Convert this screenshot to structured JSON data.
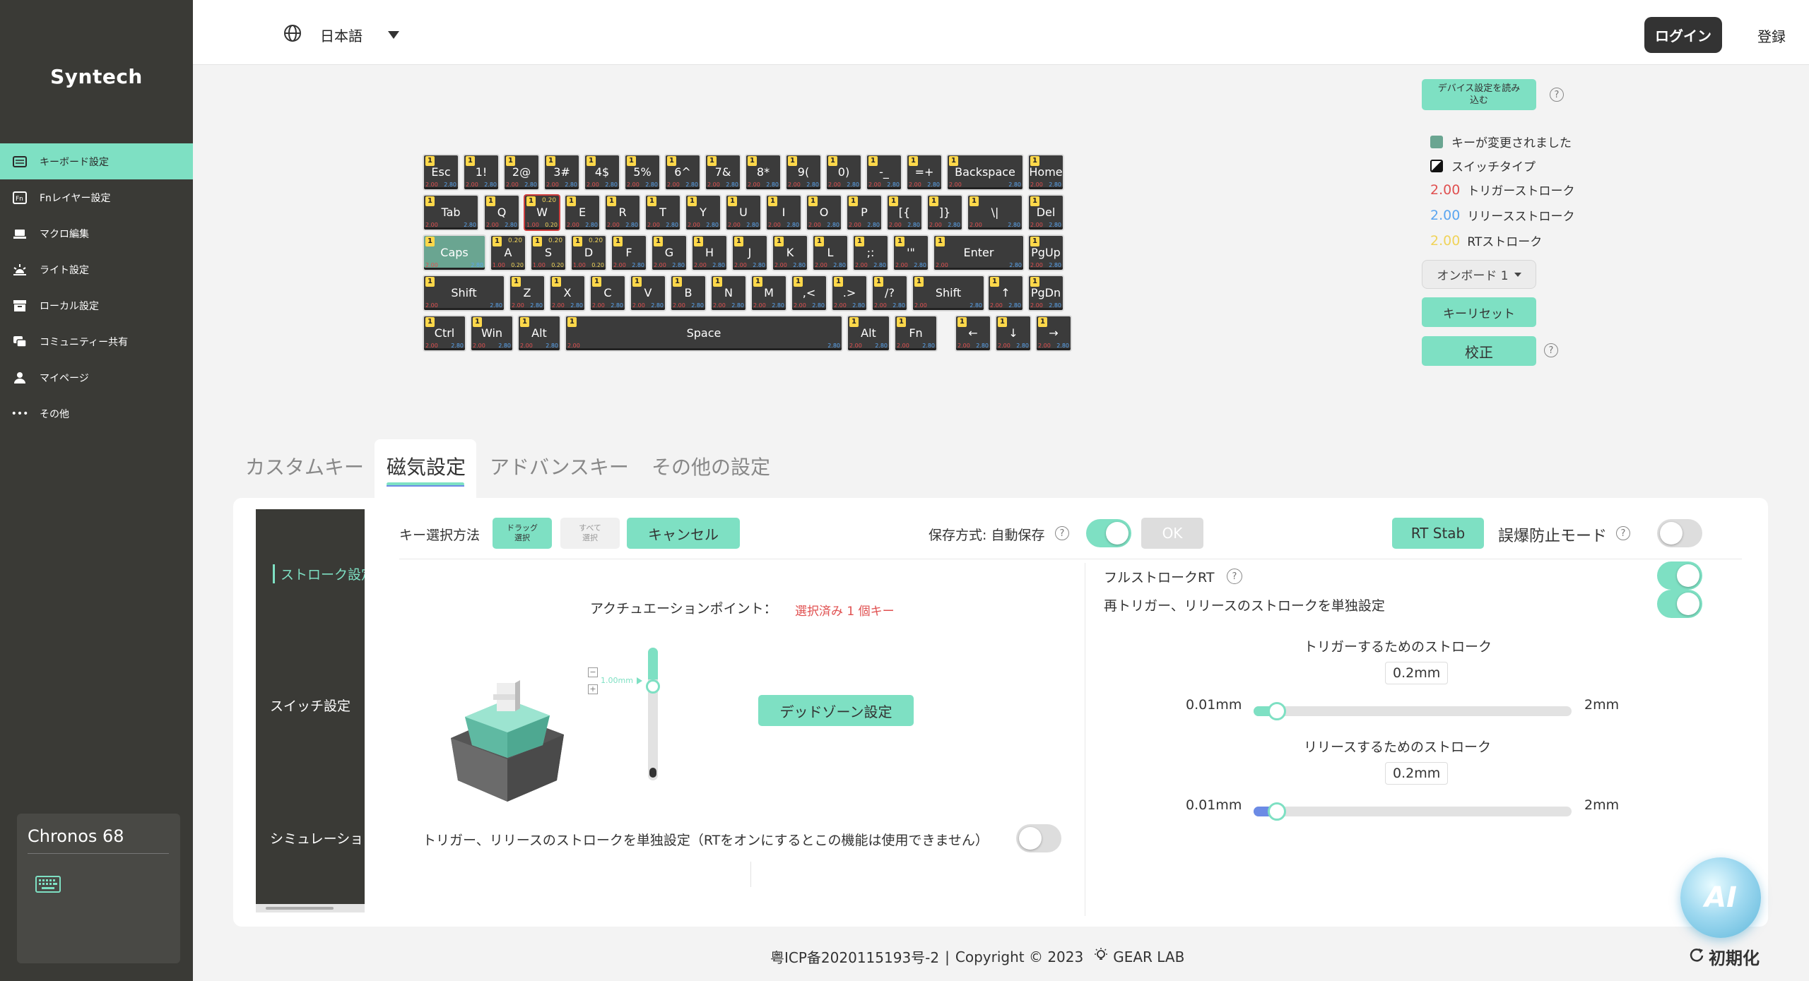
{
  "brand": "Syntech",
  "sidebar": {
    "items": [
      {
        "label": "キーボード設定",
        "icon": "keyboard-icon",
        "active": true
      },
      {
        "label": "Fnレイヤー設定",
        "icon": "fn-icon",
        "active": false
      },
      {
        "label": "マクロ編集",
        "icon": "macro-icon",
        "active": false
      },
      {
        "label": "ライト設定",
        "icon": "light-icon",
        "active": false
      },
      {
        "label": "ローカル設定",
        "icon": "archive-icon",
        "active": false
      },
      {
        "label": "コミュニティー共有",
        "icon": "community-icon",
        "active": false
      },
      {
        "label": "マイページ",
        "icon": "user-icon",
        "active": false
      },
      {
        "label": "その他",
        "icon": "more-icon",
        "active": false
      }
    ],
    "device_name": "Chronos 68"
  },
  "header": {
    "language": "日本語",
    "login": "ログイン",
    "register": "登録"
  },
  "keyboard": {
    "badge": "1",
    "trigger_default": "2.00",
    "release_default": "2.80",
    "rt_value": "0.20",
    "rt_trigger": "1.00",
    "rows": [
      [
        "Esc",
        "1!",
        "2@",
        "3#",
        "4$",
        "5%",
        "6^",
        "7&",
        "8*",
        "9(",
        "0)",
        "-_",
        "=+",
        "Backspace",
        "Home"
      ],
      [
        "Tab",
        "Q",
        "W",
        "E",
        "R",
        "T",
        "Y",
        "U",
        "I",
        "O",
        "P",
        "[{",
        "]}",
        "\\|",
        "Del"
      ],
      [
        "Caps",
        "A",
        "S",
        "D",
        "F",
        "G",
        "H",
        "J",
        "K",
        "L",
        ";:",
        "'\"",
        "Enter",
        "PgUp"
      ],
      [
        "Shift",
        "Z",
        "X",
        "C",
        "V",
        "B",
        "N",
        "M",
        ",<",
        ".>",
        "/?",
        "Shift",
        "↑",
        "PgDn"
      ],
      [
        "Ctrl",
        "Win",
        "Alt",
        "Space",
        "Alt",
        "Fn",
        "←",
        "↓",
        "→"
      ]
    ]
  },
  "right_panel": {
    "read_device": "デバイス設定を読み込む",
    "help": "?",
    "legend": {
      "changed": "キーが変更されました",
      "switch_type": "スイッチタイプ",
      "trigger_value": "2.00",
      "trigger_label": "トリガーストローク",
      "release_value": "2.00",
      "release_label": "リリースストローク",
      "rt_value": "2.00",
      "rt_label": "RTストローク"
    },
    "onboard": "オンボード 1",
    "key_reset": "キーリセット",
    "calibrate": "校正"
  },
  "tabs": [
    "カスタムキー",
    "磁気設定",
    "アドバンスキー",
    "その他の設定"
  ],
  "subnav": [
    "ストローク設定",
    "スイッチ設定",
    "シミュレーション"
  ],
  "toolbar": {
    "key_select_label": "キー選択方法",
    "drag_select": "ドラッグ選択",
    "select_all": "すべて選択",
    "cancel": "キャンセル",
    "save_mode": "保存方式: 自動保存",
    "ok": "OK",
    "rt_stab": "RT Stab",
    "anti_misfire": "誤爆防止モード"
  },
  "actuation": {
    "label": "アクチュエーションポイント：",
    "selected": "選択済み 1 個キー",
    "slider_value": "1.00mm",
    "deadzone": "デッドゾーン設定",
    "separate_note": "トリガー、リリースのストロークを単独設定（RTをオンにするとこの機能は使用できません）"
  },
  "rt_panel": {
    "full_stroke": "フルストロークRT",
    "retrigger": "再トリガー、リリースのストロークを単独設定",
    "trigger_title": "トリガーするためのストローク",
    "trigger_value": "0.2mm",
    "release_title": "リリースするためのストローク",
    "release_value": "0.2mm",
    "min": "0.01mm",
    "max": "2mm"
  },
  "footer": {
    "icp": "粤ICP备2020115193号-2",
    "sep": "|",
    "copyright": "Copyright © 2023",
    "company": "GEAR LAB",
    "reset": "初期化"
  },
  "ai": "AI",
  "colors": {
    "accent": "#7ee0c3",
    "sidebar": "#3a3a36",
    "trigger": "#e05050",
    "release": "#5aa5f0",
    "rt": "#f0d35a"
  }
}
